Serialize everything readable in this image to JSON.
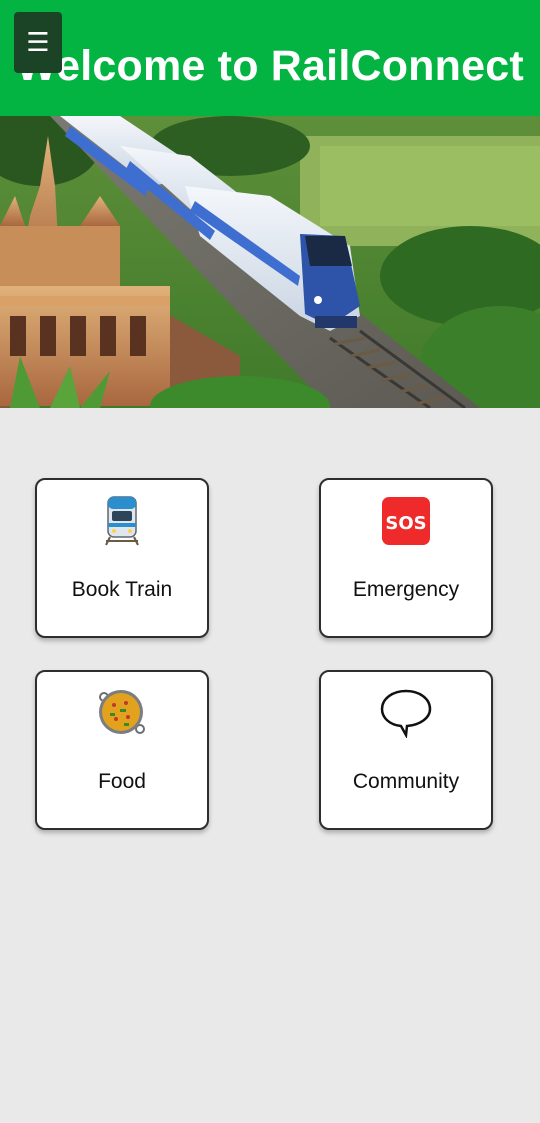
{
  "header": {
    "title": "Welcome to RailConnect",
    "menu_icon": "hamburger-menu-icon",
    "background_color": "#04b443"
  },
  "hero": {
    "image": "train-and-temple-illustration"
  },
  "tiles": [
    {
      "label": "Book Train",
      "icon": "locomotive-icon"
    },
    {
      "label": "Emergency",
      "icon": "sos-icon"
    },
    {
      "label": "Food",
      "icon": "paella-pan-icon"
    },
    {
      "label": "Community",
      "icon": "speech-bubble-icon"
    }
  ]
}
